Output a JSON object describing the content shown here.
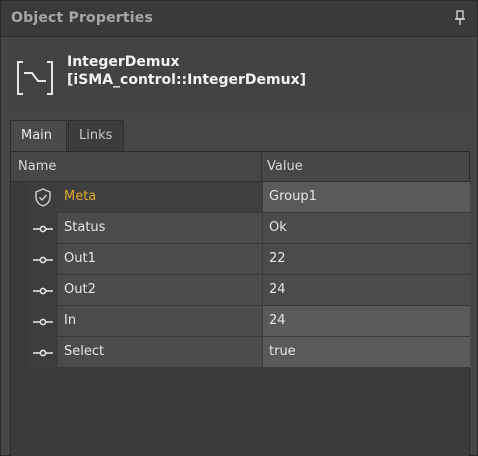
{
  "panel": {
    "title": "Object Properties"
  },
  "object": {
    "name": "IntegerDemux",
    "type": "[iSMA_control::IntegerDemux]"
  },
  "tabs": [
    {
      "label": "Main",
      "active": true
    },
    {
      "label": "Links",
      "active": false
    }
  ],
  "grid": {
    "columns": {
      "name": "Name",
      "value": "Value"
    },
    "rows": [
      {
        "name": "Meta",
        "value": "Group1",
        "icon": "shield-icon"
      },
      {
        "name": "Status",
        "value": "Ok",
        "icon": "slot-icon"
      },
      {
        "name": "Out1",
        "value": "22",
        "icon": "slot-icon"
      },
      {
        "name": "Out2",
        "value": "24",
        "icon": "slot-icon"
      },
      {
        "name": "In",
        "value": "24",
        "icon": "slot-icon"
      },
      {
        "name": "Select",
        "value": "true",
        "icon": "slot-icon"
      }
    ]
  },
  "colors": {
    "meta_label": "#e0a830",
    "background": "#464646"
  }
}
